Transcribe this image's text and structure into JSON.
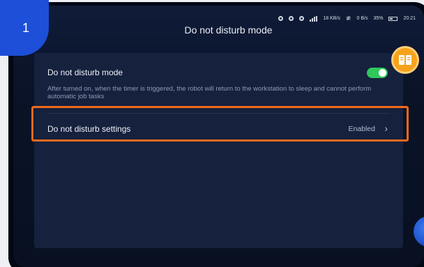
{
  "step": {
    "number": "1"
  },
  "header": {
    "title": "Do not disturb mode"
  },
  "statusbar": {
    "network_speed_1": "18",
    "network_speed_1_unit": "KB/s",
    "network_speed_2": "0",
    "network_speed_2_unit": "B/s",
    "battery_percent": "35%",
    "time": "20:21"
  },
  "dnd_mode": {
    "label": "Do not disturb mode",
    "description": "After turned on, when the timer is triggered, the robot will return to the workstation to sleep and cannot perform automatic job tasks",
    "enabled": true
  },
  "dnd_settings": {
    "label": "Do not disturb settings",
    "value": "Enabled",
    "chevron": "›"
  },
  "colors": {
    "highlight": "#f06a1c",
    "toggle_on": "#2fc75a",
    "step_badge": "#1d4fd8",
    "manual_button": "#f7a21b"
  },
  "icons": {
    "manual": "book-icon",
    "chevron": "chevron-right-icon"
  }
}
